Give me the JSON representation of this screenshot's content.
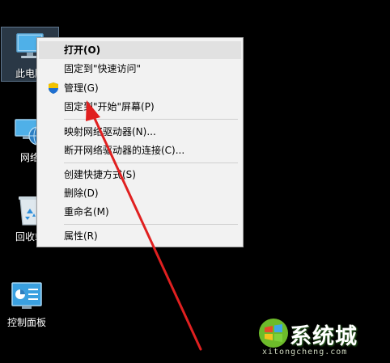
{
  "desktop": {
    "icons": [
      {
        "label": "此电脑",
        "icon": "computer-icon"
      },
      {
        "label": "网络",
        "icon": "network-icon"
      },
      {
        "label": "回收站",
        "icon": "recycle-bin-icon"
      },
      {
        "label": "控制面板",
        "icon": "control-panel-icon"
      }
    ]
  },
  "context_menu": {
    "items": [
      {
        "label": "打开(O)"
      },
      {
        "label": "固定到\"快速访问\""
      },
      {
        "label": "管理(G)",
        "icon": "uac-shield-icon"
      },
      {
        "label": "固定到\"开始\"屏幕(P)"
      },
      {
        "label": "映射网络驱动器(N)..."
      },
      {
        "label": "断开网络驱动器的连接(C)..."
      },
      {
        "label": "创建快捷方式(S)"
      },
      {
        "label": "删除(D)"
      },
      {
        "label": "重命名(M)"
      },
      {
        "label": "属性(R)"
      }
    ]
  },
  "watermark": {
    "text": "系统城",
    "subtext": "xitongcheng.com",
    "icon": "windows-logo-icon"
  },
  "colors": {
    "desktop_bg": "#000000",
    "menu_bg": "#f2f2f2",
    "menu_hover": "#e1e1e1",
    "arrow": "#e02020"
  }
}
